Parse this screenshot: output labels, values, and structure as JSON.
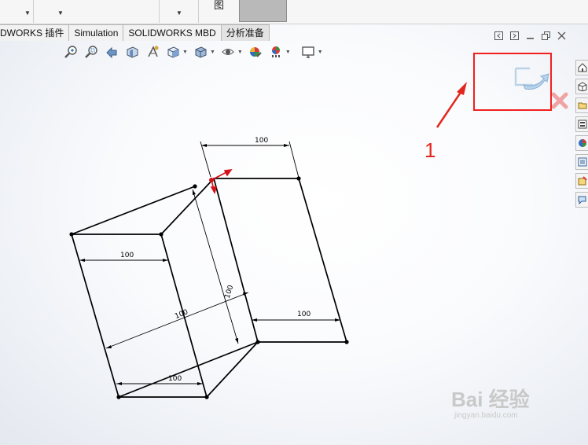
{
  "ribbon_tabs": [
    {
      "label": "DWORKS 插件"
    },
    {
      "label": "Simulation"
    },
    {
      "label": "SOLIDWORKS MBD"
    },
    {
      "label": "分析准备"
    }
  ],
  "toolbar_glyph": "图",
  "dimensions": {
    "top": "100",
    "front_top": "100",
    "front_bottom": "100",
    "diagonal": "100",
    "depth": "100",
    "right": "100"
  },
  "annotation": {
    "number": "1",
    "color": "#e3261d"
  },
  "watermark": {
    "main": "Bai 经验",
    "sub": "jingyan.baidu.com"
  },
  "hud_icons": [
    "zoom-to-fit-icon",
    "zoom-area-icon",
    "previous-view-icon",
    "section-view-icon",
    "dynamic-annotation-icon",
    "view-orientation-icon",
    "display-style-icon",
    "hide-show-icon",
    "edit-appearance-icon",
    "apply-scene-icon",
    "view-settings-icon"
  ],
  "taskpane_icons": [
    "solidworks-resources-icon",
    "design-library-icon",
    "file-explorer-icon",
    "view-palette-icon",
    "appearances-icon",
    "custom-properties-icon",
    "solidworks-forum-icon",
    "feedback-icon"
  ],
  "colors": {
    "highlight": "#f21f1f",
    "confirm_icon": "#9ec3df",
    "cancel_icon": "#f0a3a3",
    "origin": "#d4121c"
  }
}
